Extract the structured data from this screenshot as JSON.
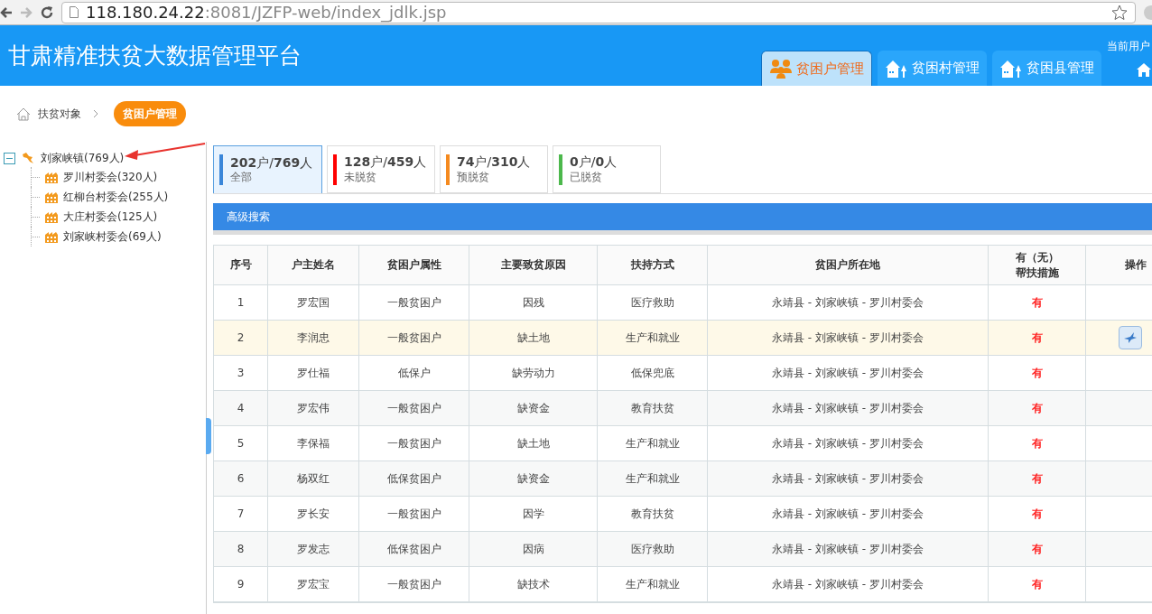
{
  "browser": {
    "url_host": "118.180.24.22",
    "url_path": ":8081/JZFP-web/index_jdlk.jsp"
  },
  "header": {
    "title": "甘肃精准扶贫大数据管理平台",
    "user_label": "当前用户",
    "tabs": [
      {
        "label": "贫困户管理",
        "kind": "people",
        "selected": true
      },
      {
        "label": "贫困村管理",
        "kind": "village",
        "selected": false
      },
      {
        "label": "贫困县管理",
        "kind": "village",
        "selected": false
      }
    ]
  },
  "breadcrumb": {
    "items": [
      "扶贫对象"
    ],
    "current": "贫困户管理"
  },
  "tree": {
    "label": "刘家峡镇(769人)",
    "expanded": true,
    "children": [
      {
        "label": "罗川村委会(320人)"
      },
      {
        "label": "红柳台村委会(255人)"
      },
      {
        "label": "大庄村委会(125人)"
      },
      {
        "label": "刘家峡村委会(69人)"
      }
    ]
  },
  "stats": [
    {
      "value": "**202**户/**769**人",
      "label": "全部",
      "color": "#3a86d9",
      "selected": true
    },
    {
      "value": "**128**户/**459**人",
      "label": "未脱贫",
      "color": "#ff0000",
      "selected": false
    },
    {
      "value": "**74**户/**310**人",
      "label": "预脱贫",
      "color": "#f58a1f",
      "selected": false
    },
    {
      "value": "**0**户/**0**人",
      "label": "已脱贫",
      "color": "#4cb84c",
      "selected": false
    }
  ],
  "search_bar": {
    "title": "高级搜索"
  },
  "table": {
    "columns": [
      "序号",
      "户主姓名",
      "贫困户属性",
      "主要致贫原因",
      "扶持方式",
      "贫困户所在地",
      "有（无）帮扶措施",
      "操作"
    ],
    "rows": [
      {
        "cells": [
          "1",
          "罗宏国",
          "一般贫困户",
          "因残",
          "医疗救助",
          "永靖县 - 刘家峡镇 - 罗川村委会",
          "有"
        ],
        "hovered": false
      },
      {
        "cells": [
          "2",
          "李润忠",
          "一般贫困户",
          "缺土地",
          "生产和就业",
          "永靖县 - 刘家峡镇 - 罗川村委会",
          "有"
        ],
        "hovered": true
      },
      {
        "cells": [
          "3",
          "罗仕福",
          "低保户",
          "缺劳动力",
          "低保兜底",
          "永靖县 - 刘家峡镇 - 罗川村委会",
          "有"
        ],
        "hovered": false
      },
      {
        "cells": [
          "4",
          "罗宏伟",
          "一般贫困户",
          "缺资金",
          "教育扶贫",
          "永靖县 - 刘家峡镇 - 罗川村委会",
          "有"
        ],
        "hovered": false
      },
      {
        "cells": [
          "5",
          "李保福",
          "一般贫困户",
          "缺土地",
          "生产和就业",
          "永靖县 - 刘家峡镇 - 罗川村委会",
          "有"
        ],
        "hovered": false
      },
      {
        "cells": [
          "6",
          "杨双红",
          "低保贫困户",
          "缺资金",
          "生产和就业",
          "永靖县 - 刘家峡镇 - 罗川村委会",
          "有"
        ],
        "hovered": false
      },
      {
        "cells": [
          "7",
          "罗长安",
          "一般贫困户",
          "因学",
          "教育扶贫",
          "永靖县 - 刘家峡镇 - 罗川村委会",
          "有"
        ],
        "hovered": false
      },
      {
        "cells": [
          "8",
          "罗发志",
          "低保贫困户",
          "因病",
          "医疗救助",
          "永靖县 - 刘家峡镇 - 罗川村委会",
          "有"
        ],
        "hovered": false
      },
      {
        "cells": [
          "9",
          "罗宏宝",
          "一般贫困户",
          "缺技术",
          "生产和就业",
          "永靖县 - 刘家峡镇 - 罗川村委会",
          "有"
        ],
        "hovered": false
      }
    ]
  }
}
